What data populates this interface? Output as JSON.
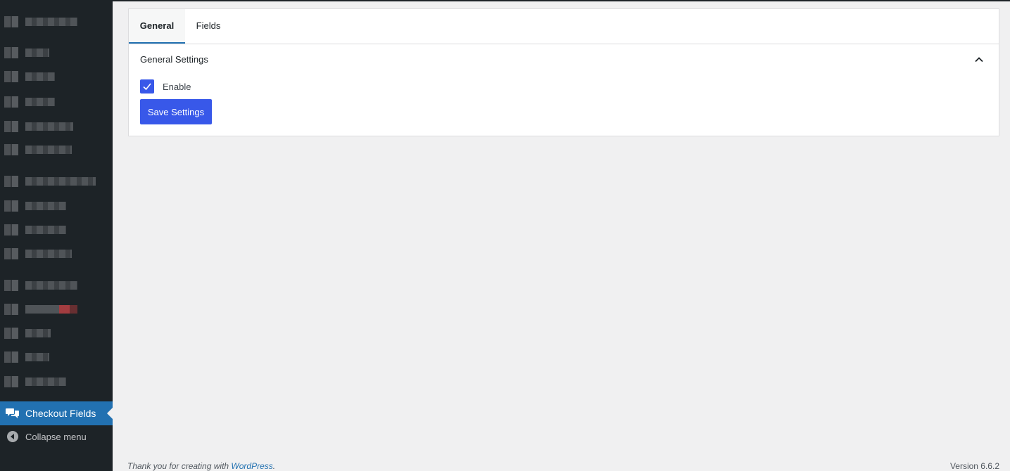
{
  "sidebar": {
    "active_item": "Checkout Fields",
    "collapse_label": "Collapse menu"
  },
  "tabs": [
    {
      "label": "General",
      "active": true
    },
    {
      "label": "Fields",
      "active": false
    }
  ],
  "settings": {
    "section_title": "General Settings",
    "enable_label": "Enable",
    "enable_checked": true,
    "save_label": "Save Settings"
  },
  "footer": {
    "thanks_text": "Thank you for creating with ",
    "wp_link": "WordPress",
    "trailing": ".",
    "version": "Version 6.6.2"
  },
  "colors": {
    "sidebar_bg": "#1d2327",
    "active_menu": "#2271b1",
    "primary_button": "#3858e9"
  }
}
